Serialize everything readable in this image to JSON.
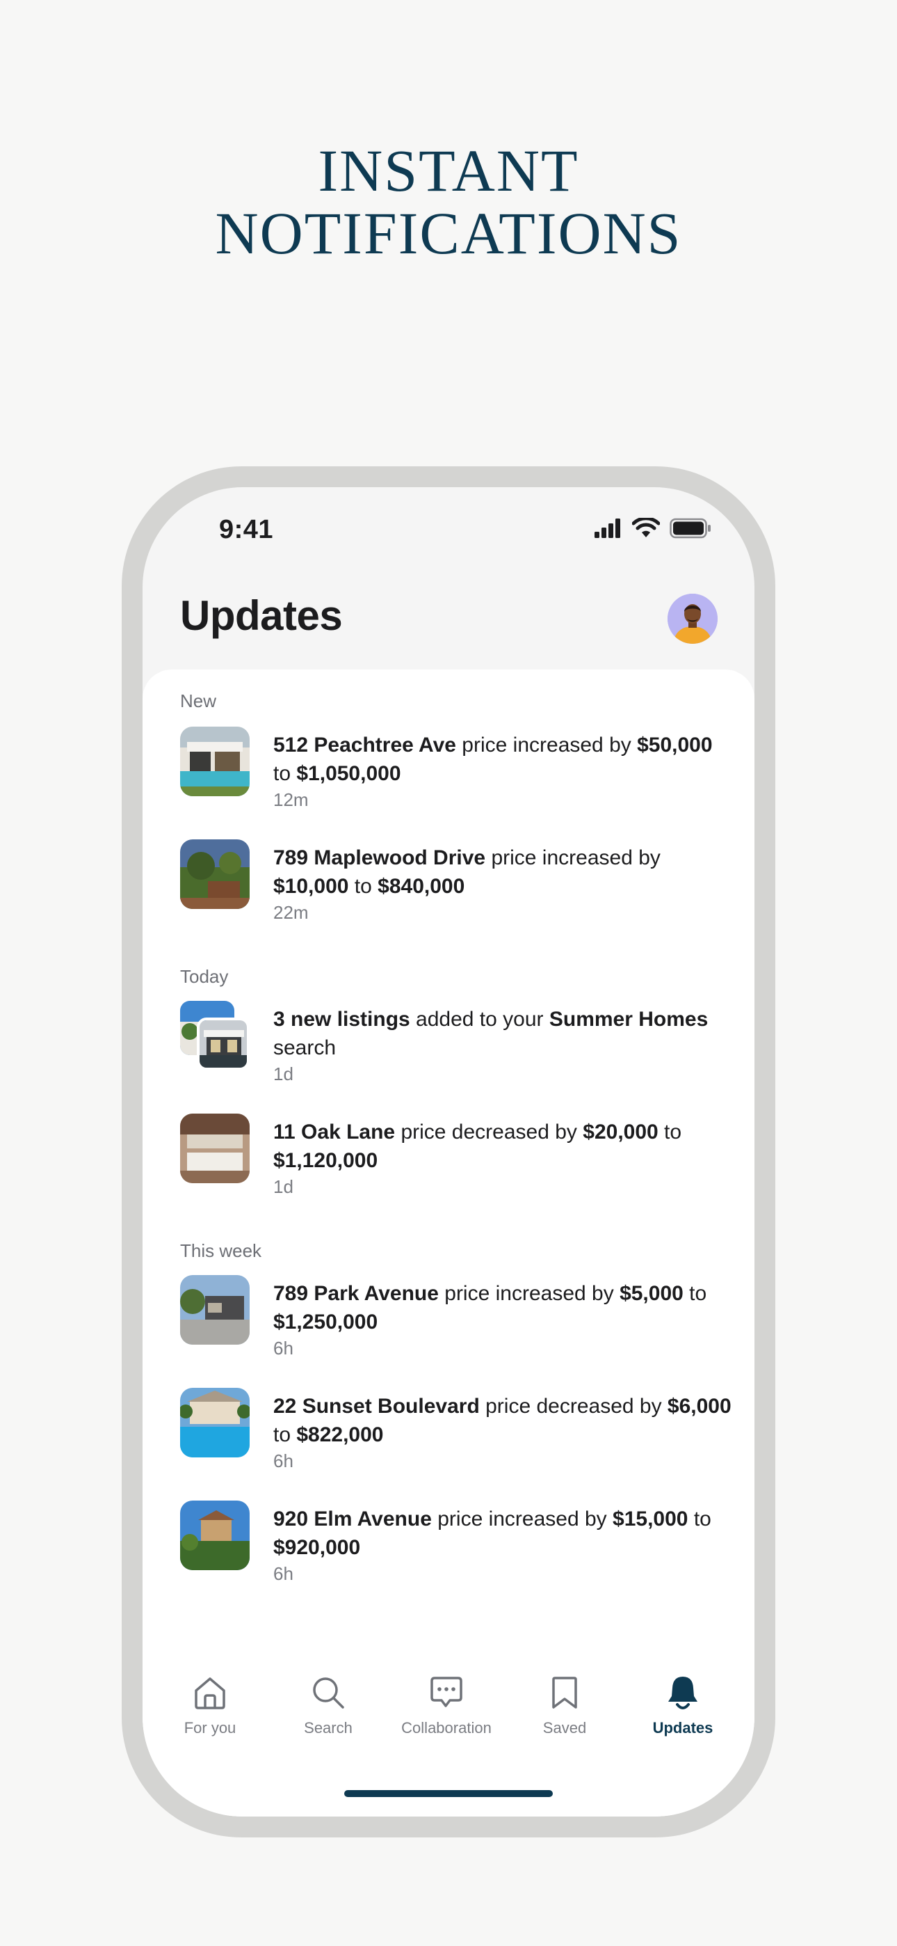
{
  "headline": {
    "line1": "INSTANT",
    "line2": "NOTIFICATIONS"
  },
  "status_bar": {
    "time": "9:41"
  },
  "page": {
    "title": "Updates"
  },
  "sections": {
    "new": "New",
    "today": "Today",
    "this_week": "This week"
  },
  "items": [
    {
      "parts": [
        {
          "t": "512 Peachtree Ave",
          "b": true
        },
        {
          "t": " price increased by "
        },
        {
          "t": "$50,000",
          "b": true
        },
        {
          "t": " to "
        },
        {
          "t": "$1,050,000",
          "b": true
        }
      ],
      "time": "12m"
    },
    {
      "parts": [
        {
          "t": "789 Maplewood Drive",
          "b": true
        },
        {
          "t": " price increased by "
        },
        {
          "t": "$10,000",
          "b": true
        },
        {
          "t": " to "
        },
        {
          "t": "$840,000",
          "b": true
        }
      ],
      "time": "22m"
    },
    {
      "parts": [
        {
          "t": "3 new listings",
          "b": true
        },
        {
          "t": " added to your "
        },
        {
          "t": "Summer Homes",
          "b": true
        },
        {
          "t": " search"
        }
      ],
      "time": "1d"
    },
    {
      "parts": [
        {
          "t": "11 Oak Lane",
          "b": true
        },
        {
          "t": " price decreased by "
        },
        {
          "t": "$20,000",
          "b": true
        },
        {
          "t": " to "
        },
        {
          "t": "$1,120,000",
          "b": true
        }
      ],
      "time": "1d"
    },
    {
      "parts": [
        {
          "t": "789 Park Avenue",
          "b": true
        },
        {
          "t": " price increased by "
        },
        {
          "t": "$5,000",
          "b": true
        },
        {
          "t": " to "
        },
        {
          "t": "$1,250,000",
          "b": true
        }
      ],
      "time": "6h"
    },
    {
      "parts": [
        {
          "t": "22 Sunset Boulevard",
          "b": true
        },
        {
          "t": " price decreased by "
        },
        {
          "t": "$6,000",
          "b": true
        },
        {
          "t": " to "
        },
        {
          "t": "$822,000",
          "b": true
        }
      ],
      "time": "6h"
    },
    {
      "parts": [
        {
          "t": "920 Elm Avenue",
          "b": true
        },
        {
          "t": " price increased by "
        },
        {
          "t": "$15,000",
          "b": true
        },
        {
          "t": " to "
        },
        {
          "t": "$920,000",
          "b": true
        }
      ],
      "time": "6h"
    }
  ],
  "tabs": [
    {
      "label": "For you",
      "icon": "home-icon"
    },
    {
      "label": "Search",
      "icon": "search-icon"
    },
    {
      "label": "Collaboration",
      "icon": "chat-icon"
    },
    {
      "label": "Saved",
      "icon": "bookmark-icon"
    },
    {
      "label": "Updates",
      "icon": "bell-icon",
      "active": true
    }
  ],
  "colors": {
    "brand": "#0e3a52",
    "frame": "#d4d4d2",
    "muted": "#7a7c82",
    "avatar_bg": "#b9b4f2"
  }
}
